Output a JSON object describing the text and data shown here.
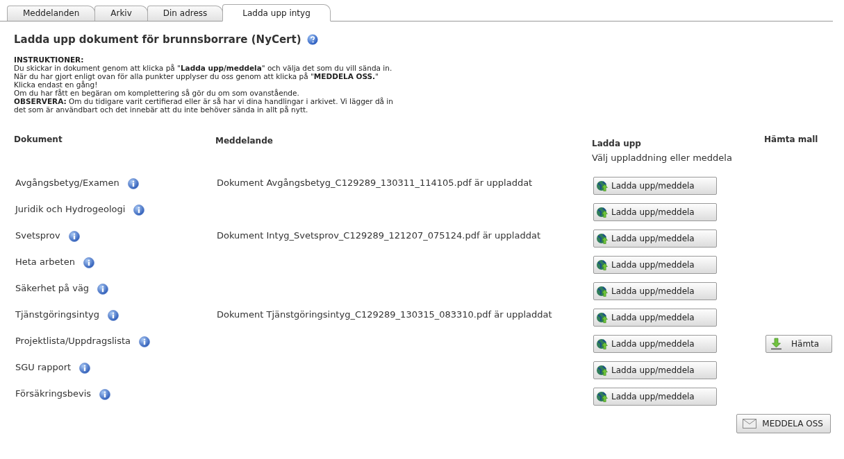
{
  "tabs": [
    {
      "label": "Meddelanden",
      "selected": false
    },
    {
      "label": "Arkiv",
      "selected": false
    },
    {
      "label": "Din adress",
      "selected": false
    },
    {
      "label": "Ladda upp intyg",
      "selected": true
    }
  ],
  "heading": "Ladda upp dokument för brunnsborrare (NyCert)",
  "instructions": {
    "title": "INSTRUKTIONER:",
    "lines": [
      "Du skickar in dokument genom att klicka på \"**Ladda upp/meddela**\" och välja det som du vill sända in.",
      "När du har gjort enligt ovan för alla punkter upplyser du oss genom att klicka på \"**MEDDELA OSS.**\"",
      "Klicka endast en gång!",
      "Om du har fått en begäran om komplettering så gör du om som ovanstående.",
      "**OBSERVERA:** Om du tidigare varit certifierad eller är så har vi dina handlingar i arkivet. Vi lägger då in",
      "det som är användbart och det innebär att du inte behöver sända in allt på nytt."
    ]
  },
  "table": {
    "columns": [
      "Dokument",
      "Meddelande",
      "Ladda upp",
      "Hämta mall"
    ],
    "upload_hint": "Välj uppladdning eller meddela",
    "rows": [
      {
        "document": "Avgångsbetyg/Examen",
        "message": "Dokument Avgångsbetyg_C129289_130311_114105.pdf är uppladdat",
        "upload": "Ladda upp/meddela"
      },
      {
        "document": "Juridik och Hydrogeologi",
        "upload": "Ladda upp/meddela"
      },
      {
        "document": "Svetsprov",
        "message": "Dokument Intyg_Svetsprov_C129289_121207_075124.pdf är uppladdat",
        "upload": "Ladda upp/meddela"
      },
      {
        "document": "Heta arbeten",
        "upload": "Ladda upp/meddela"
      },
      {
        "document": "Säkerhet på väg",
        "upload": "Ladda upp/meddela"
      },
      {
        "document": "Tjänstgöringsintyg",
        "message": "Dokument Tjänstgöringsintyg_C129289_130315_083310.pdf är uppladdat",
        "upload": "Ladda upp/meddela"
      },
      {
        "document": "Projektlista/Uppdragslista",
        "upload": "Ladda upp/meddela",
        "template": "Hämta"
      },
      {
        "document": "SGU rapport",
        "upload": "Ladda upp/meddela"
      },
      {
        "document": "Försäkringsbevis",
        "upload": "Ladda upp/meddela"
      }
    ]
  },
  "submit_button": "MEDDELA OSS"
}
